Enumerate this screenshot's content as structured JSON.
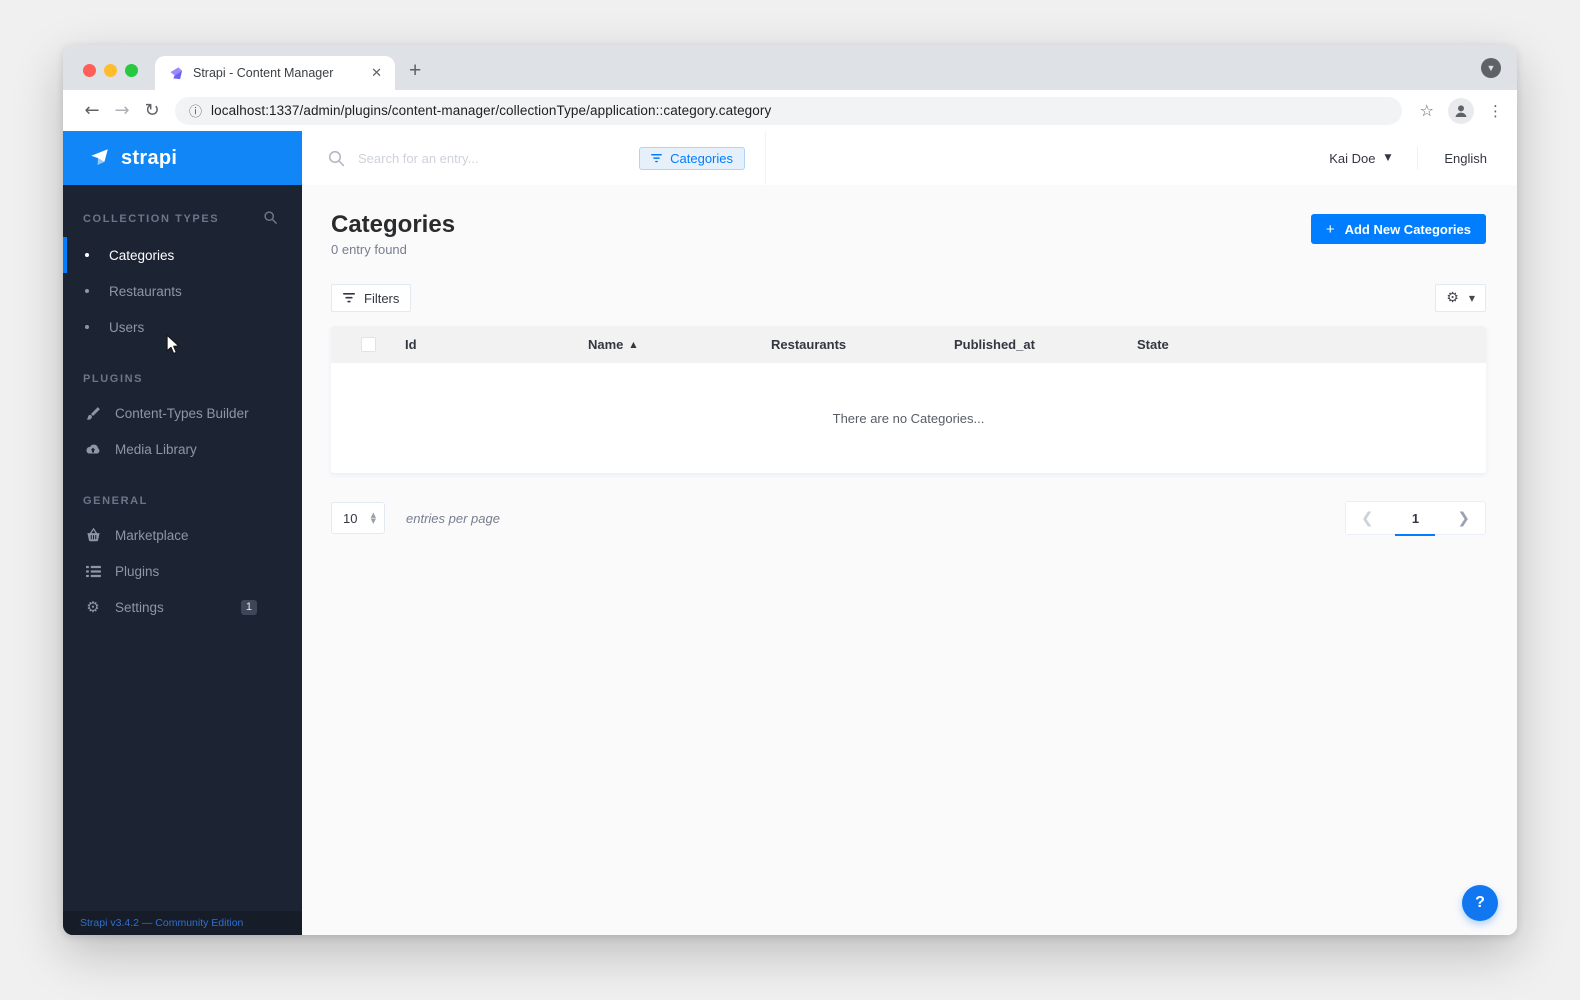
{
  "browser": {
    "tab_title": "Strapi - Content Manager",
    "url": "localhost:1337/admin/plugins/content-manager/collectionType/application::category.category"
  },
  "sidebar": {
    "logo_text": "strapi",
    "sections": [
      {
        "label": "COLLECTION TYPES",
        "items": [
          {
            "label": "Categories",
            "active": true
          },
          {
            "label": "Restaurants"
          },
          {
            "label": "Users"
          }
        ]
      },
      {
        "label": "PLUGINS",
        "items": [
          {
            "label": "Content-Types Builder",
            "icon": "paintbrush-icon"
          },
          {
            "label": "Media Library",
            "icon": "cloud-upload-icon"
          }
        ]
      },
      {
        "label": "GENERAL",
        "items": [
          {
            "label": "Marketplace",
            "icon": "basket-icon"
          },
          {
            "label": "Plugins",
            "icon": "list-icon"
          },
          {
            "label": "Settings",
            "icon": "gear-icon",
            "badge": "1"
          }
        ]
      }
    ],
    "footer": "Strapi v3.4.2 — Community Edition"
  },
  "header": {
    "search_placeholder": "Search for an entry...",
    "filter_chip_label": "Categories",
    "user_name": "Kai Doe",
    "language": "English"
  },
  "page": {
    "title": "Categories",
    "subtitle": "0 entry found",
    "add_button_label": "Add New Categories",
    "filters_button_label": "Filters"
  },
  "table": {
    "columns": [
      "Id",
      "Name",
      "Restaurants",
      "Published_at",
      "State"
    ],
    "sorted_column": "Name",
    "sort_direction": "asc",
    "empty_message": "There are no Categories...",
    "rows": []
  },
  "pagination": {
    "entries_per_page": "10",
    "entries_label": "entries per page",
    "current_page": "1"
  },
  "help": {
    "label": "?"
  },
  "colors": {
    "accent": "#007eff",
    "logo_bar": "#1086f7",
    "sidebar_bg": "#1c2433",
    "chip_bg": "#e6f0fb",
    "chip_border": "#aed4fb"
  }
}
